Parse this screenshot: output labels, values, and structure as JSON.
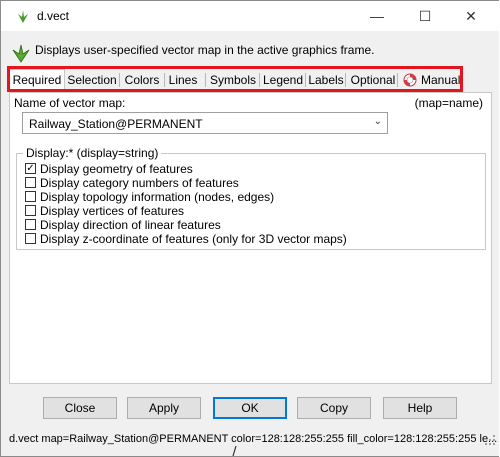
{
  "window": {
    "title": "d.vect",
    "minimize": "—",
    "maximize": "☐",
    "close": "✕"
  },
  "header": {
    "description": "Displays user-specified vector map in the active graphics frame."
  },
  "tabs": [
    {
      "label": "Required",
      "active": true
    },
    {
      "label": "Selection"
    },
    {
      "label": "Colors"
    },
    {
      "label": "Lines"
    },
    {
      "label": "Symbols"
    },
    {
      "label": "Legend"
    },
    {
      "label": "Labels"
    },
    {
      "label": "Optional"
    },
    {
      "label": "Manual"
    }
  ],
  "map": {
    "label": "Name of vector map:",
    "param": "(map=name)",
    "value": "Railway_Station@PERMANENT"
  },
  "display": {
    "title": "Display:* (display=string)",
    "options": [
      {
        "label": "Display geometry of features",
        "checked": true
      },
      {
        "label": "Display category numbers of features",
        "checked": false
      },
      {
        "label": "Display topology information (nodes, edges)",
        "checked": false
      },
      {
        "label": "Display vertices of features",
        "checked": false
      },
      {
        "label": "Display direction of linear features",
        "checked": false
      },
      {
        "label": "Display z-coordinate of features (only for 3D vector maps)",
        "checked": false
      }
    ]
  },
  "buttons": {
    "close": "Close",
    "apply": "Apply",
    "ok": "OK",
    "copy": "Copy",
    "help": "Help"
  },
  "status": {
    "command": "d.vect map=Railway_Station@PERMANENT color=128:128:255:255 fill_color=128:128:255:255 le..."
  },
  "colors": {
    "highlight": "#e3161e",
    "ok_border": "#0078d7"
  }
}
